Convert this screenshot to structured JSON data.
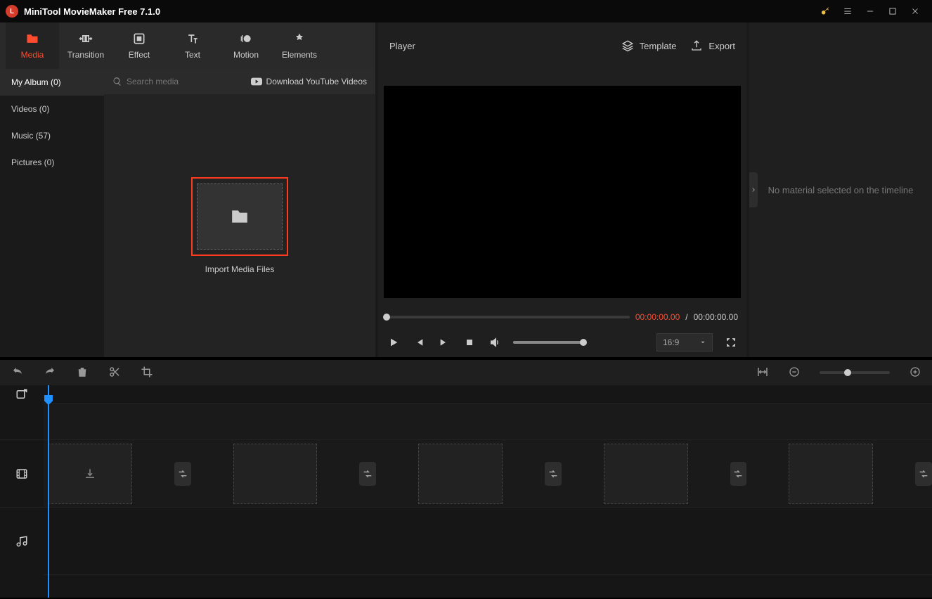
{
  "app": {
    "title": "MiniTool MovieMaker Free 7.1.0"
  },
  "toptabs": {
    "media": "Media",
    "transition": "Transition",
    "effect": "Effect",
    "text": "Text",
    "motion": "Motion",
    "elements": "Elements"
  },
  "sidebar": {
    "myalbum": "My Album (0)",
    "videos": "Videos (0)",
    "music": "Music (57)",
    "pictures": "Pictures (0)"
  },
  "media": {
    "search_placeholder": "Search media",
    "download_yt": "Download YouTube Videos",
    "import_label": "Import Media Files"
  },
  "player": {
    "label": "Player",
    "template": "Template",
    "export": "Export",
    "cur": "00:00:00.00",
    "sep": "/",
    "total": "00:00:00.00",
    "aspect": "16:9"
  },
  "rightpanel": {
    "empty": "No material selected on the timeline"
  }
}
